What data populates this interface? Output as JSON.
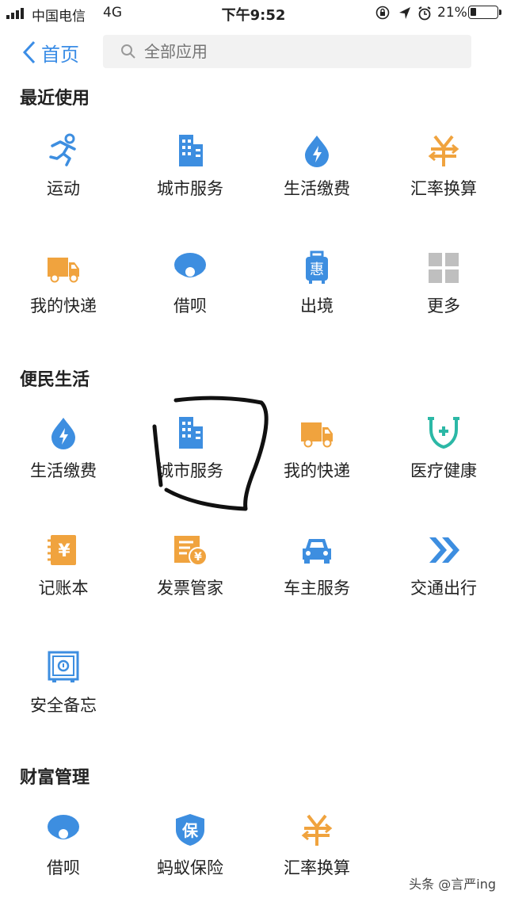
{
  "status_bar": {
    "carrier": "中国电信",
    "network": "4G",
    "time": "下午9:52",
    "battery": "21%"
  },
  "header": {
    "back_label": "首页",
    "search_placeholder": "全部应用"
  },
  "sections": [
    {
      "title": "最近使用",
      "items": [
        {
          "label": "运动",
          "icon": "running-icon"
        },
        {
          "label": "城市服务",
          "icon": "building-icon"
        },
        {
          "label": "生活缴费",
          "icon": "water-drop-bolt-icon"
        },
        {
          "label": "汇率换算",
          "icon": "yuan-exchange-icon"
        },
        {
          "label": "我的快递",
          "icon": "delivery-truck-icon"
        },
        {
          "label": "借呗",
          "icon": "pearl-shell-icon"
        },
        {
          "label": "出境",
          "icon": "luggage-icon"
        },
        {
          "label": "更多",
          "icon": "grid-more-icon"
        }
      ]
    },
    {
      "title": "便民生活",
      "items": [
        {
          "label": "生活缴费",
          "icon": "water-drop-bolt-icon"
        },
        {
          "label": "城市服务",
          "icon": "building-icon"
        },
        {
          "label": "我的快递",
          "icon": "delivery-truck-icon"
        },
        {
          "label": "医疗健康",
          "icon": "stethoscope-icon"
        },
        {
          "label": "记账本",
          "icon": "ledger-icon"
        },
        {
          "label": "发票管家",
          "icon": "invoice-icon"
        },
        {
          "label": "车主服务",
          "icon": "car-icon"
        },
        {
          "label": "交通出行",
          "icon": "double-chevron-icon"
        },
        {
          "label": "安全备忘",
          "icon": "safe-icon"
        }
      ]
    },
    {
      "title": "财富管理",
      "items": [
        {
          "label": "借呗",
          "icon": "pearl-shell-icon"
        },
        {
          "label": "蚂蚁保险",
          "icon": "shield-bao-icon"
        },
        {
          "label": "汇率换算",
          "icon": "yuan-exchange-icon"
        }
      ]
    }
  ],
  "icon_glyphs": {
    "ledger": "¥",
    "invoice": "¥",
    "luggage": "惠",
    "shield": "保"
  },
  "colors": {
    "blue": "#3d8ee0",
    "orange": "#f0a33e",
    "teal": "#2cb8a6",
    "gray": "#bfbfbf"
  },
  "watermark": "头条 @言严ing"
}
